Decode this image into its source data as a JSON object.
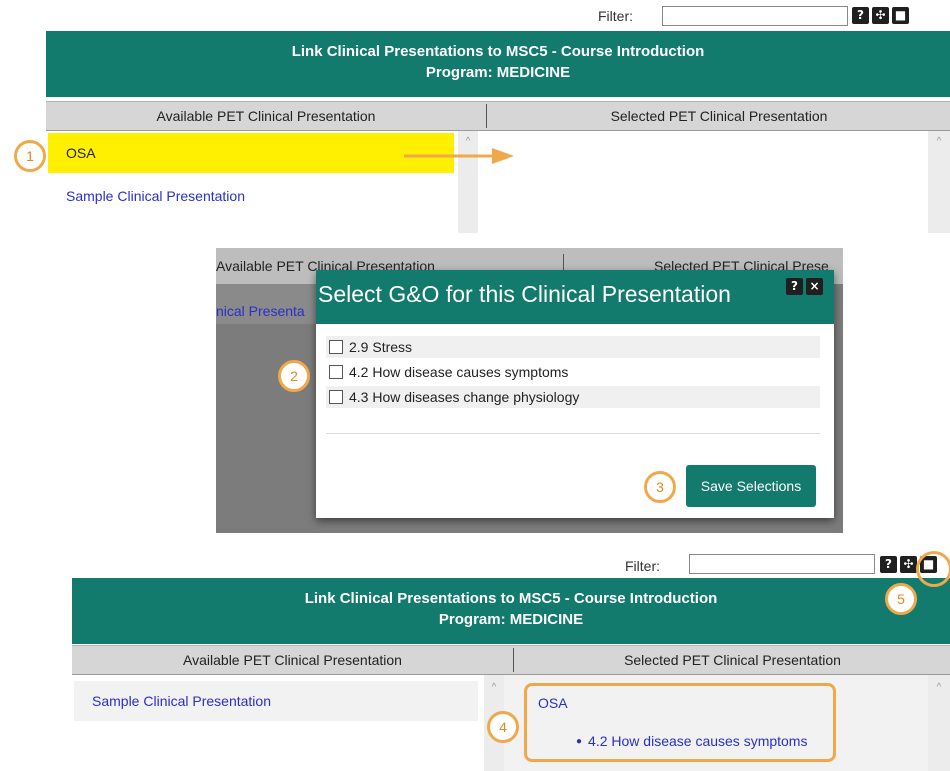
{
  "panel1": {
    "filter_label": "Filter:",
    "help_btn": "?",
    "move_btn": "✣",
    "max_btn": "■",
    "title_line1": "Link Clinical Presentations to MSC5 - Course Introduction",
    "title_line2": "Program: MEDICINE",
    "available_header": "Available PET Clinical Presentation",
    "selected_header": "Selected PET Clinical Presentation",
    "available_items": [
      "OSA",
      "Sample Clinical Presentation"
    ]
  },
  "modal": {
    "bg_available_header": "Available PET Clinical Presentation",
    "bg_selected_header": "Selected PET Clinical Prese",
    "bg_link": "nical Presenta",
    "title": "Select G&O for this Clinical Presentation",
    "help_btn": "?",
    "close_btn": "×",
    "options": [
      "2.9 Stress",
      "4.2 How disease causes symptoms",
      "4.3 How diseases change physiology"
    ],
    "save_label": "Save Selections"
  },
  "panel2": {
    "filter_label": "Filter:",
    "help_btn": "?",
    "move_btn": "✣",
    "max_btn": "■",
    "title_line1": "Link Clinical Presentations to MSC5 - Course Introduction",
    "title_line2": "Program: MEDICINE",
    "available_header": "Available PET Clinical Presentation",
    "selected_header": "Selected PET Clinical Presentation",
    "available_items": [
      "Sample Clinical Presentation"
    ],
    "selected_item": "OSA",
    "selected_sub_item": "4.2 How disease causes symptoms"
  },
  "callouts": [
    "1",
    "2",
    "3",
    "4",
    "5"
  ],
  "colors": {
    "header_teal": "#137a6e",
    "highlight_yellow": "#ffef00",
    "callout_orange": "#f0a94a",
    "link_blue": "#2a2fc9"
  }
}
